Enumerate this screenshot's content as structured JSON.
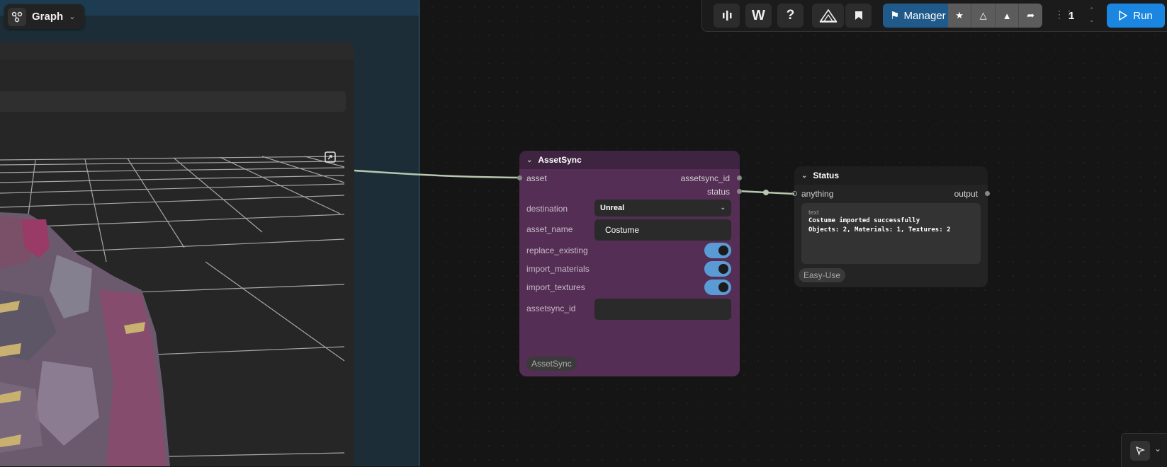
{
  "graph_menu": {
    "label": "Graph"
  },
  "toolbar": {
    "manager_label": "Manager",
    "queue_count": "1",
    "run_label": "Run"
  },
  "assetsync_node": {
    "title": "AssetSync",
    "inputs": [
      "asset"
    ],
    "outputs": [
      "assetsync_id",
      "status"
    ],
    "widgets": {
      "destination": {
        "label": "destination",
        "value": "Unreal"
      },
      "asset_name": {
        "label": "asset_name",
        "value": "Costume"
      },
      "replace_existing": {
        "label": "replace_existing",
        "value": true
      },
      "import_materials": {
        "label": "import_materials",
        "value": true
      },
      "import_textures": {
        "label": "import_textures",
        "value": true
      },
      "assetsync_id": {
        "label": "assetsync_id",
        "value": ""
      }
    },
    "badge": "AssetSync"
  },
  "status_node": {
    "title": "Status",
    "input": "anything",
    "output": "output",
    "text_label": "text",
    "text_lines": [
      "Costume imported successfully",
      "Objects: 2, Materials: 1, Textures: 2"
    ],
    "badge": "Easy-Use"
  },
  "colors": {
    "assetsync_body": "#542e55",
    "assetsync_header": "#3e2440",
    "toggle_on": "#5b9bd5",
    "run_button": "#1a86e0",
    "manager_button": "#1f5a8a"
  }
}
